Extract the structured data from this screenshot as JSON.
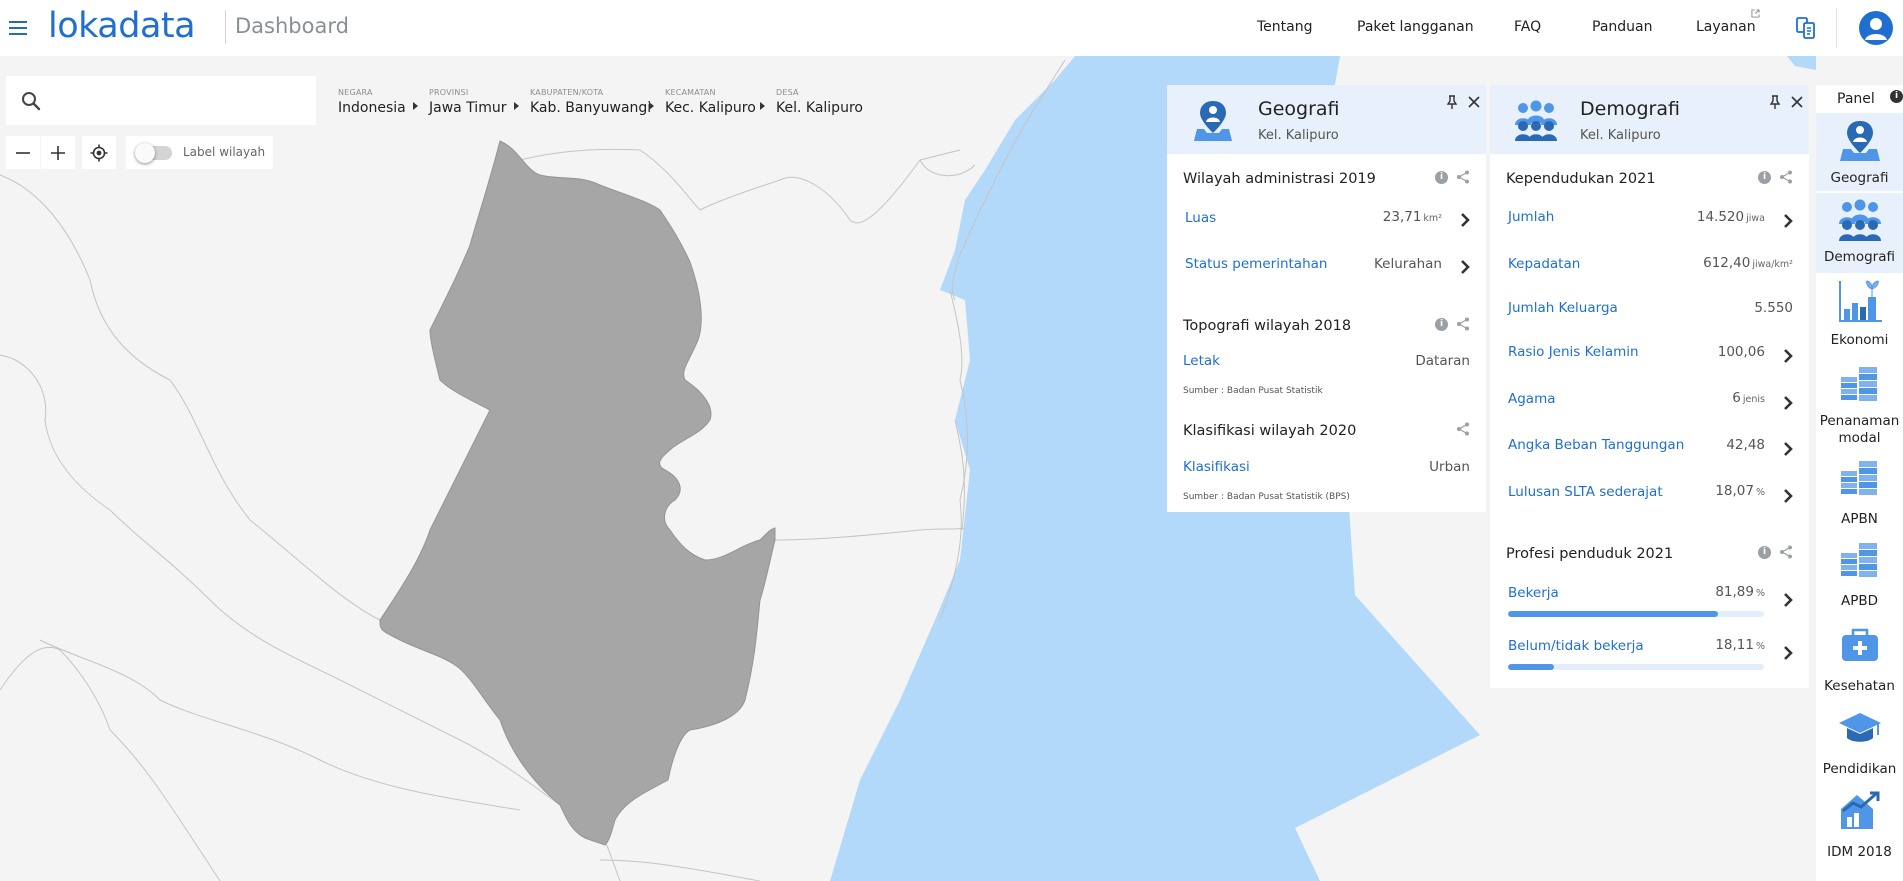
{
  "header": {
    "logo": "lokadata",
    "title": "Dashboard",
    "nav": [
      "Tentang",
      "Paket langganan",
      "FAQ",
      "Panduan",
      "Layanan"
    ]
  },
  "search": {
    "placeholder": "",
    "value": ""
  },
  "breadcrumb": [
    {
      "level": "NEGARA",
      "name": "Indonesia"
    },
    {
      "level": "PROVINSI",
      "name": "Jawa Timur"
    },
    {
      "level": "KABUPATEN/KOTA",
      "name": "Kab. Banyuwangi"
    },
    {
      "level": "KECAMATAN",
      "name": "Kec. Kalipuro"
    },
    {
      "level": "DESA",
      "name": "Kel. Kalipuro"
    }
  ],
  "map_controls": {
    "label_toggle": "Label wilayah",
    "label_on": false
  },
  "geografi": {
    "title": "Geografi",
    "subtitle": "Kel. Kalipuro",
    "sections": [
      {
        "title": "Wilayah administrasi 2019",
        "rows": [
          {
            "label": "Luas",
            "value": "23,71",
            "unit": "km²"
          },
          {
            "label": "Status pemerintahan",
            "value": "Kelurahan",
            "unit": ""
          }
        ],
        "source": ""
      },
      {
        "title": "Topografi wilayah 2018",
        "rows": [
          {
            "label": "Letak",
            "value": "Dataran",
            "unit": ""
          }
        ],
        "source": "Sumber : Badan Pusat Statistik"
      },
      {
        "title": "Klasifikasi wilayah 2020",
        "rows": [
          {
            "label": "Klasifikasi",
            "value": "Urban",
            "unit": ""
          }
        ],
        "source": "Sumber : Badan Pusat Statistik (BPS)"
      }
    ]
  },
  "demografi": {
    "title": "Demografi",
    "subtitle": "Kel. Kalipuro",
    "sections": [
      {
        "title": "Kependudukan 2021",
        "rows": [
          {
            "label": "Jumlah",
            "value": "14.520",
            "unit": "jiwa"
          },
          {
            "label": "Kepadatan",
            "value": "612,40",
            "unit": "jiwa/km²"
          },
          {
            "label": "Jumlah Keluarga",
            "value": "5.550",
            "unit": ""
          },
          {
            "label": "Rasio Jenis Kelamin",
            "value": "100,06",
            "unit": ""
          },
          {
            "label": "Agama",
            "value": "6",
            "unit": "jenis"
          },
          {
            "label": "Angka Beban Tanggungan",
            "value": "42,48",
            "unit": ""
          },
          {
            "label": "Lulusan SLTA sederajat",
            "value": "18,07",
            "unit": "%"
          }
        ]
      },
      {
        "title": "Profesi penduduk 2021",
        "rows": [
          {
            "label": "Bekerja",
            "value": "81,89",
            "unit": "%",
            "fraction": 0.8189
          },
          {
            "label": "Belum/tidak bekerja",
            "value": "18,11",
            "unit": "%",
            "fraction": 0.1811
          }
        ]
      }
    ]
  },
  "rail": {
    "title": "Panel",
    "items": [
      {
        "label": "Geografi",
        "icon": "map-pin-person-icon",
        "active": true
      },
      {
        "label": "Demografi",
        "icon": "people-group-icon",
        "active": true
      },
      {
        "label": "Ekonomi",
        "icon": "bar-chart-plant-icon",
        "active": false
      },
      {
        "label": "Penanaman modal",
        "icon": "money-stack-icon",
        "active": false
      },
      {
        "label": "APBN",
        "icon": "money-stack-icon",
        "active": false
      },
      {
        "label": "APBD",
        "icon": "money-stack-icon",
        "active": false
      },
      {
        "label": "Kesehatan",
        "icon": "medical-kit-icon",
        "active": false
      },
      {
        "label": "Pendidikan",
        "icon": "graduation-cap-icon",
        "active": false
      },
      {
        "label": "IDM 2018",
        "icon": "house-chart-icon",
        "active": false
      }
    ]
  },
  "colors": {
    "brand": "#1f6fd1",
    "panel_header": "#e8f0fb",
    "sea": "#b3d9fa",
    "region_fill": "#a6a6a6",
    "link": "#1f6fd1"
  }
}
